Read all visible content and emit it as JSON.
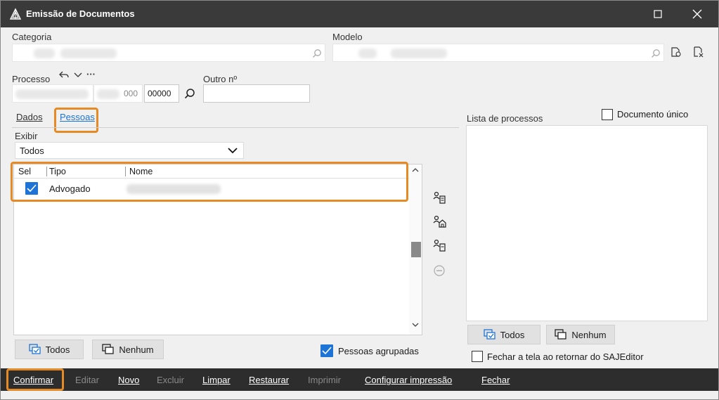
{
  "window": {
    "title": "Emissão de Documentos"
  },
  "header": {
    "categoria_label": "Categoria",
    "modelo_label": "Modelo",
    "processo_label": "Processo",
    "outro_label": "Outro nº",
    "processo_part2": "000",
    "processo_part3": "00000",
    "more_label": "···"
  },
  "tabs": [
    {
      "label": "Dados",
      "active": false
    },
    {
      "label": "Pessoas",
      "active": true
    }
  ],
  "exibir": {
    "label": "Exibir",
    "selected": "Todos"
  },
  "grid": {
    "columns": [
      "Sel",
      "Tipo",
      "Nome"
    ],
    "rows": [
      {
        "selected": true,
        "tipo": "Advogado"
      }
    ]
  },
  "left_buttons": {
    "todos": "Todos",
    "nenhum": "Nenhum",
    "pessoas_agrupadas": "Pessoas agrupadas",
    "pessoas_agrupadas_checked": true
  },
  "right_panel": {
    "lista_label": "Lista de processos",
    "documento_unico": "Documento único",
    "documento_unico_checked": false,
    "todos": "Todos",
    "nenhum": "Nenhum",
    "fechar_tela": "Fechar a tela ao retornar do SAJEditor",
    "fechar_tela_checked": false
  },
  "footer": {
    "items": [
      {
        "label": "Confirmar",
        "enabled": true
      },
      {
        "label": "Editar",
        "enabled": false
      },
      {
        "label": "Novo",
        "enabled": true
      },
      {
        "label": "Excluir",
        "enabled": false
      },
      {
        "label": "Limpar",
        "enabled": true
      },
      {
        "label": "Restaurar",
        "enabled": true
      },
      {
        "label": "Imprimir",
        "enabled": false
      },
      {
        "label": "Configurar impressão",
        "enabled": true
      },
      {
        "label": "Fechar",
        "enabled": true
      }
    ]
  },
  "colors": {
    "accent": "#1e74d6",
    "highlight": "#e58a24",
    "titlebar": "#3a3a3a",
    "bottombar": "#2d2d2d"
  },
  "icons": [
    "app-icon",
    "maximize-icon",
    "close-icon",
    "search-icon",
    "edit-model-icon",
    "reply-icon",
    "chevron-down-icon",
    "check-icon",
    "add-person-icon",
    "add-house-icon",
    "person-doc-icon",
    "remove-icon",
    "select-all-icon",
    "select-none-icon"
  ]
}
